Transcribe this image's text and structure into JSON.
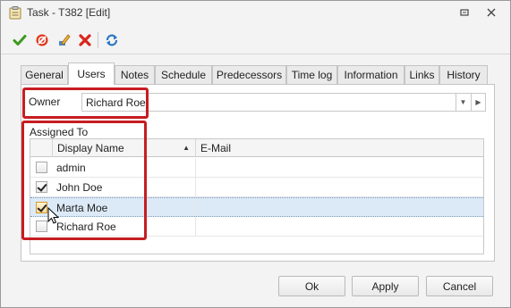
{
  "window": {
    "title": "Task - T382 [Edit]",
    "icons": [
      "task-clipboard-icon",
      "restore-icon",
      "close-icon"
    ]
  },
  "toolbar": {
    "icons": [
      "save-check-icon",
      "cancel-icon",
      "edit-pencil-icon",
      "delete-x-icon",
      "refresh-icon"
    ],
    "colors": {
      "save": "#3d9a1f",
      "cancel": "#e0361b",
      "delete": "#d8261c",
      "refresh": "#2b78c5"
    }
  },
  "tabs": [
    {
      "label": "General",
      "active": false
    },
    {
      "label": "Users",
      "active": true
    },
    {
      "label": "Notes",
      "active": false
    },
    {
      "label": "Schedule",
      "active": false
    },
    {
      "label": "Predecessors",
      "active": false
    },
    {
      "label": "Time log",
      "active": false
    },
    {
      "label": "Information",
      "active": false
    },
    {
      "label": "Links",
      "active": false
    },
    {
      "label": "History",
      "active": false
    }
  ],
  "owner": {
    "label": "Owner",
    "value": "Richard Roe"
  },
  "assigned": {
    "label": "Assigned To",
    "columns": {
      "display_name": "Display Name",
      "email": "E-Mail"
    },
    "sort": "ascending",
    "rows": [
      {
        "name": "admin",
        "email": "",
        "checked": false
      },
      {
        "name": "John Doe",
        "email": "",
        "checked": true
      },
      {
        "name": "Marta Moe",
        "email": "",
        "checked": true,
        "selected": true
      },
      {
        "name": "Richard Roe",
        "email": "",
        "checked": false
      }
    ]
  },
  "buttons": {
    "ok": "Ok",
    "apply": "Apply",
    "cancel": "Cancel"
  },
  "highlight_color": "#c61d22"
}
